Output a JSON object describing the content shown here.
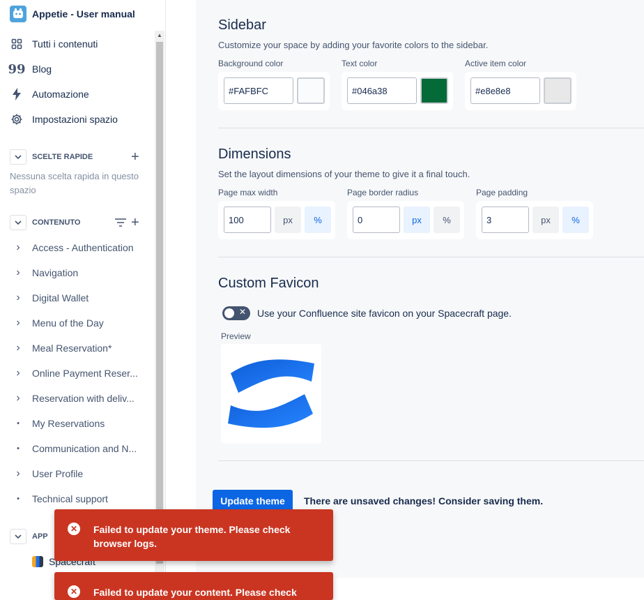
{
  "sidebar": {
    "space_title": "Appetie - User manual",
    "nav": [
      {
        "label": "Tutti i contenuti",
        "icon": "grid-icon"
      },
      {
        "label": "Blog",
        "icon": "quote-icon"
      },
      {
        "label": "Automazione",
        "icon": "lightning-icon"
      },
      {
        "label": "Impostazioni spazio",
        "icon": "gear-icon"
      }
    ],
    "quick": {
      "title": "SCELTE RAPIDE",
      "empty": "Nessuna scelta rapida in questo spazio"
    },
    "content": {
      "title": "CONTENUTO",
      "items": [
        {
          "label": "Access - Authentication",
          "marker": "›"
        },
        {
          "label": "Navigation",
          "marker": "›"
        },
        {
          "label": "Digital Wallet",
          "marker": "›"
        },
        {
          "label": "Menu of the Day",
          "marker": "›"
        },
        {
          "label": "Meal Reservation*",
          "marker": "›"
        },
        {
          "label": "Online Payment Reser...",
          "marker": "›"
        },
        {
          "label": "Reservation with deliv...",
          "marker": "›"
        },
        {
          "label": "My Reservations",
          "marker": "•"
        },
        {
          "label": "Communication and N...",
          "marker": "•"
        },
        {
          "label": "User Profile",
          "marker": "›"
        },
        {
          "label": "Technical support",
          "marker": "•"
        }
      ]
    },
    "apps": {
      "title": "APP",
      "item": "Spacecraft"
    }
  },
  "sidebar_section": {
    "title": "Sidebar",
    "description": "Customize your space by adding your favorite colors to the sidebar.",
    "background": {
      "label": "Background color",
      "value": "#FAFBFC",
      "color": "#FAFBFC"
    },
    "text": {
      "label": "Text color",
      "value": "#046a38",
      "color": "#046a38"
    },
    "active": {
      "label": "Active item color",
      "value": "#e8e8e8",
      "color": "#e8e8e8"
    }
  },
  "dimensions": {
    "title": "Dimensions",
    "description": "Set the layout dimensions of your theme to give it a final touch.",
    "max_width": {
      "label": "Page max width",
      "value": "100",
      "unit_selected": "%"
    },
    "border_radius": {
      "label": "Page border radius",
      "value": "0",
      "unit_selected": "px"
    },
    "padding": {
      "label": "Page padding",
      "value": "3",
      "unit_selected": "%"
    },
    "unit_px": "px",
    "unit_pct": "%"
  },
  "favicon": {
    "title": "Custom Favicon",
    "toggle_label": "Use your Confluence site favicon on your Spacecraft page.",
    "toggle_on": false,
    "preview_label": "Preview"
  },
  "actions": {
    "update_label": "Update theme",
    "unsaved_message": "There are unsaved changes! Consider saving them."
  },
  "toasts": [
    {
      "message": "Failed to update your theme. Please check browser logs."
    },
    {
      "message": "Failed to update your content. Please check"
    }
  ],
  "colors": {
    "primary": "#0c66e4",
    "error": "#ca3521"
  }
}
